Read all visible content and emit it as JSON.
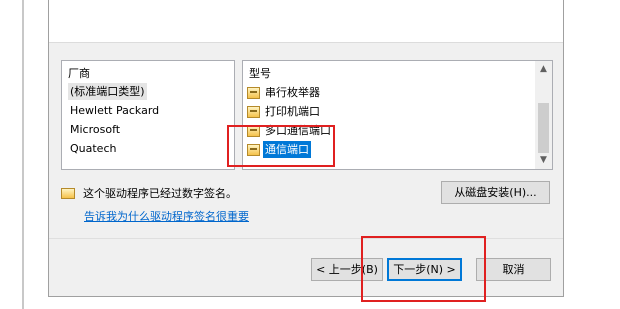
{
  "manufacturers": {
    "header": "厂商",
    "items": [
      {
        "label": "(标准端口类型)",
        "selected": true
      },
      {
        "label": "Hewlett Packard",
        "selected": false
      },
      {
        "label": "Microsoft",
        "selected": false
      },
      {
        "label": "Quatech",
        "selected": false
      }
    ]
  },
  "models": {
    "header": "型号",
    "items": [
      {
        "label": "串行枚举器",
        "icon": "port-icon",
        "selected": false
      },
      {
        "label": "打印机端口",
        "icon": "port-icon",
        "selected": false
      },
      {
        "label": "多口通信端口",
        "icon": "port-icon",
        "selected": false
      },
      {
        "label": "通信端口",
        "icon": "port-icon",
        "selected": true
      }
    ]
  },
  "signature": {
    "text": "这个驱动程序已经过数字签名。",
    "link": "告诉我为什么驱动程序签名很重要",
    "icon": "certificate-icon"
  },
  "buttons": {
    "have_disk": "从磁盘安装(H)...",
    "back": "< 上一步(B)",
    "next": "下一步(N) >",
    "cancel": "取消"
  },
  "scrollbar": {
    "up": "▲",
    "down": "▼"
  },
  "colors": {
    "selection": "#0078d7",
    "annotation": "#e02020",
    "link": "#0066cc"
  }
}
